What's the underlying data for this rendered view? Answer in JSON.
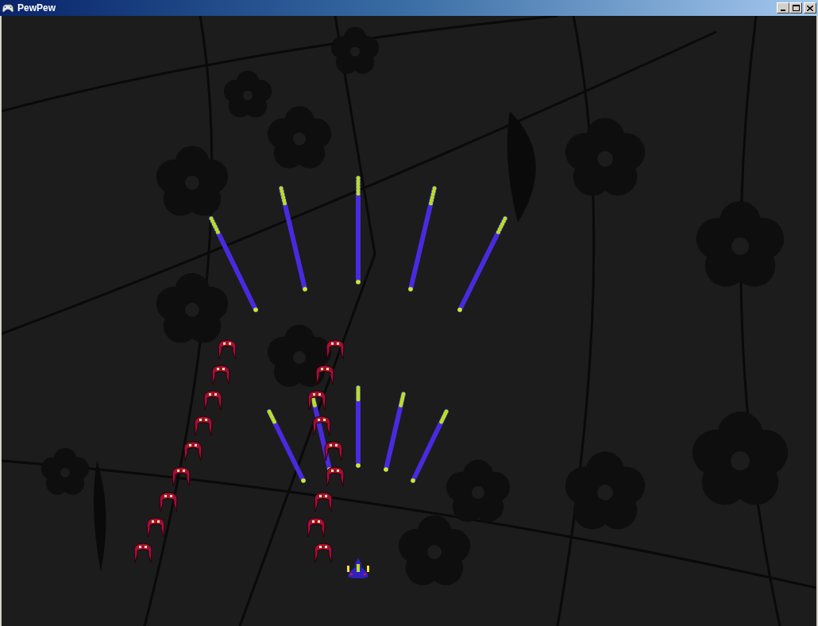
{
  "window": {
    "title": "PewPew"
  }
}
